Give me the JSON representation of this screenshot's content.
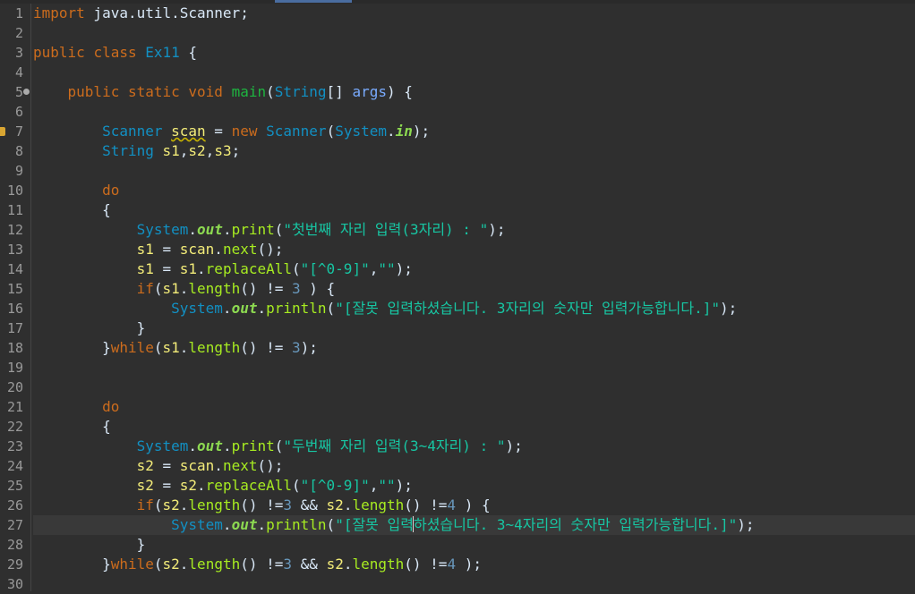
{
  "editor": {
    "colors": {
      "background": "#2f2f2f",
      "keyword": "#cc6c1d",
      "type": "#1290c3",
      "local_variable": "#f3ec79",
      "method": "#a7ec21",
      "string": "#17c6a3",
      "static_field": "#8dda51",
      "number": "#6897bb"
    },
    "current_line": 27,
    "lines": [
      {
        "n": "1",
        "t": [
          {
            "c": "kw",
            "s": "import"
          },
          {
            "c": "tx",
            "s": " java.util.Scanner;"
          }
        ]
      },
      {
        "n": "2",
        "t": []
      },
      {
        "n": "3",
        "t": [
          {
            "c": "kw",
            "s": "public"
          },
          {
            "c": "tx",
            "s": " "
          },
          {
            "c": "kw",
            "s": "class"
          },
          {
            "c": "tx",
            "s": " "
          },
          {
            "c": "cls",
            "s": "Ex11"
          },
          {
            "c": "tx",
            "s": " {"
          }
        ]
      },
      {
        "n": "4",
        "t": []
      },
      {
        "n": "5",
        "ann": "override-icon",
        "t": [
          {
            "c": "tx",
            "s": "    "
          },
          {
            "c": "kw",
            "s": "public"
          },
          {
            "c": "tx",
            "s": " "
          },
          {
            "c": "kw",
            "s": "static"
          },
          {
            "c": "tx",
            "s": " "
          },
          {
            "c": "kw",
            "s": "void"
          },
          {
            "c": "tx",
            "s": " "
          },
          {
            "c": "fn",
            "s": "main"
          },
          {
            "c": "tx",
            "s": "("
          },
          {
            "c": "cls",
            "s": "String"
          },
          {
            "c": "tx",
            "s": "[] "
          },
          {
            "c": "prm",
            "s": "args"
          },
          {
            "c": "tx",
            "s": ") {"
          }
        ]
      },
      {
        "n": "6",
        "t": []
      },
      {
        "n": "7",
        "marker": "warning-marker-icon",
        "t": [
          {
            "c": "tx",
            "s": "        "
          },
          {
            "c": "cls",
            "s": "Scanner"
          },
          {
            "c": "tx",
            "s": " "
          },
          {
            "c": "var warn",
            "s": "scan"
          },
          {
            "c": "tx",
            "s": " = "
          },
          {
            "c": "kw",
            "s": "new"
          },
          {
            "c": "tx",
            "s": " "
          },
          {
            "c": "cls",
            "s": "Scanner"
          },
          {
            "c": "tx",
            "s": "("
          },
          {
            "c": "cls",
            "s": "System"
          },
          {
            "c": "tx",
            "s": "."
          },
          {
            "c": "fld",
            "s": "in"
          },
          {
            "c": "tx",
            "s": ");"
          }
        ]
      },
      {
        "n": "8",
        "t": [
          {
            "c": "tx",
            "s": "        "
          },
          {
            "c": "cls",
            "s": "String"
          },
          {
            "c": "tx",
            "s": " "
          },
          {
            "c": "var",
            "s": "s1"
          },
          {
            "c": "tx",
            "s": ","
          },
          {
            "c": "var",
            "s": "s2"
          },
          {
            "c": "tx",
            "s": ","
          },
          {
            "c": "var",
            "s": "s3"
          },
          {
            "c": "tx",
            "s": ";"
          }
        ]
      },
      {
        "n": "9",
        "t": []
      },
      {
        "n": "10",
        "t": [
          {
            "c": "tx",
            "s": "        "
          },
          {
            "c": "kw",
            "s": "do"
          }
        ]
      },
      {
        "n": "11",
        "t": [
          {
            "c": "tx",
            "s": "        {"
          }
        ]
      },
      {
        "n": "12",
        "t": [
          {
            "c": "tx",
            "s": "            "
          },
          {
            "c": "cls",
            "s": "System"
          },
          {
            "c": "tx",
            "s": "."
          },
          {
            "c": "fld",
            "s": "out"
          },
          {
            "c": "tx",
            "s": "."
          },
          {
            "c": "mth",
            "s": "print"
          },
          {
            "c": "tx",
            "s": "("
          },
          {
            "c": "str",
            "s": "\"첫번째 자리 입력(3자리) : \""
          },
          {
            "c": "tx",
            "s": ");"
          }
        ]
      },
      {
        "n": "13",
        "t": [
          {
            "c": "tx",
            "s": "            "
          },
          {
            "c": "var",
            "s": "s1"
          },
          {
            "c": "tx",
            "s": " = "
          },
          {
            "c": "var",
            "s": "scan"
          },
          {
            "c": "tx",
            "s": "."
          },
          {
            "c": "mth",
            "s": "next"
          },
          {
            "c": "tx",
            "s": "();"
          }
        ]
      },
      {
        "n": "14",
        "t": [
          {
            "c": "tx",
            "s": "            "
          },
          {
            "c": "var",
            "s": "s1"
          },
          {
            "c": "tx",
            "s": " = "
          },
          {
            "c": "var",
            "s": "s1"
          },
          {
            "c": "tx",
            "s": "."
          },
          {
            "c": "mth",
            "s": "replaceAll"
          },
          {
            "c": "tx",
            "s": "("
          },
          {
            "c": "str",
            "s": "\"[^0-9]\""
          },
          {
            "c": "tx",
            "s": ","
          },
          {
            "c": "str",
            "s": "\"\""
          },
          {
            "c": "tx",
            "s": ");"
          }
        ]
      },
      {
        "n": "15",
        "t": [
          {
            "c": "tx",
            "s": "            "
          },
          {
            "c": "kw",
            "s": "if"
          },
          {
            "c": "tx",
            "s": "("
          },
          {
            "c": "var",
            "s": "s1"
          },
          {
            "c": "tx",
            "s": "."
          },
          {
            "c": "mth",
            "s": "length"
          },
          {
            "c": "tx",
            "s": "() != "
          },
          {
            "c": "numl",
            "s": "3"
          },
          {
            "c": "tx",
            "s": " ) {"
          }
        ]
      },
      {
        "n": "16",
        "t": [
          {
            "c": "tx",
            "s": "                "
          },
          {
            "c": "cls",
            "s": "System"
          },
          {
            "c": "tx",
            "s": "."
          },
          {
            "c": "fld",
            "s": "out"
          },
          {
            "c": "tx",
            "s": "."
          },
          {
            "c": "mth",
            "s": "println"
          },
          {
            "c": "tx",
            "s": "("
          },
          {
            "c": "str",
            "s": "\"[잘못 입력하셨습니다. 3자리의 숫자만 입력가능합니다.]\""
          },
          {
            "c": "tx",
            "s": ");"
          }
        ]
      },
      {
        "n": "17",
        "t": [
          {
            "c": "tx",
            "s": "            }"
          }
        ]
      },
      {
        "n": "18",
        "t": [
          {
            "c": "tx",
            "s": "        }"
          },
          {
            "c": "kw",
            "s": "while"
          },
          {
            "c": "tx",
            "s": "("
          },
          {
            "c": "var",
            "s": "s1"
          },
          {
            "c": "tx",
            "s": "."
          },
          {
            "c": "mth",
            "s": "length"
          },
          {
            "c": "tx",
            "s": "() != "
          },
          {
            "c": "numl",
            "s": "3"
          },
          {
            "c": "tx",
            "s": ");"
          }
        ]
      },
      {
        "n": "19",
        "t": []
      },
      {
        "n": "20",
        "t": []
      },
      {
        "n": "21",
        "t": [
          {
            "c": "tx",
            "s": "        "
          },
          {
            "c": "kw",
            "s": "do"
          }
        ]
      },
      {
        "n": "22",
        "t": [
          {
            "c": "tx",
            "s": "        {"
          }
        ]
      },
      {
        "n": "23",
        "t": [
          {
            "c": "tx",
            "s": "            "
          },
          {
            "c": "cls",
            "s": "System"
          },
          {
            "c": "tx",
            "s": "."
          },
          {
            "c": "fld",
            "s": "out"
          },
          {
            "c": "tx",
            "s": "."
          },
          {
            "c": "mth",
            "s": "print"
          },
          {
            "c": "tx",
            "s": "("
          },
          {
            "c": "str",
            "s": "\"두번째 자리 입력(3~4자리) : \""
          },
          {
            "c": "tx",
            "s": ");"
          }
        ]
      },
      {
        "n": "24",
        "t": [
          {
            "c": "tx",
            "s": "            "
          },
          {
            "c": "var",
            "s": "s2"
          },
          {
            "c": "tx",
            "s": " = "
          },
          {
            "c": "var",
            "s": "scan"
          },
          {
            "c": "tx",
            "s": "."
          },
          {
            "c": "mth",
            "s": "next"
          },
          {
            "c": "tx",
            "s": "();"
          }
        ]
      },
      {
        "n": "25",
        "t": [
          {
            "c": "tx",
            "s": "            "
          },
          {
            "c": "var",
            "s": "s2"
          },
          {
            "c": "tx",
            "s": " = "
          },
          {
            "c": "var",
            "s": "s2"
          },
          {
            "c": "tx",
            "s": "."
          },
          {
            "c": "mth",
            "s": "replaceAll"
          },
          {
            "c": "tx",
            "s": "("
          },
          {
            "c": "str",
            "s": "\"[^0-9]\""
          },
          {
            "c": "tx",
            "s": ","
          },
          {
            "c": "str",
            "s": "\"\""
          },
          {
            "c": "tx",
            "s": ");"
          }
        ]
      },
      {
        "n": "26",
        "t": [
          {
            "c": "tx",
            "s": "            "
          },
          {
            "c": "kw",
            "s": "if"
          },
          {
            "c": "tx",
            "s": "("
          },
          {
            "c": "var",
            "s": "s2"
          },
          {
            "c": "tx",
            "s": "."
          },
          {
            "c": "mth",
            "s": "length"
          },
          {
            "c": "tx",
            "s": "() !="
          },
          {
            "c": "numl",
            "s": "3"
          },
          {
            "c": "tx",
            "s": " && "
          },
          {
            "c": "var",
            "s": "s2"
          },
          {
            "c": "tx",
            "s": "."
          },
          {
            "c": "mth",
            "s": "length"
          },
          {
            "c": "tx",
            "s": "() !="
          },
          {
            "c": "numl",
            "s": "4"
          },
          {
            "c": "tx",
            "s": " ) {"
          }
        ]
      },
      {
        "n": "27",
        "t": [
          {
            "c": "tx",
            "s": "                "
          },
          {
            "c": "cls",
            "s": "System"
          },
          {
            "c": "tx",
            "s": "."
          },
          {
            "c": "fld",
            "s": "out"
          },
          {
            "c": "tx",
            "s": "."
          },
          {
            "c": "mth",
            "s": "println"
          },
          {
            "c": "tx",
            "s": "("
          },
          {
            "c": "str",
            "s": "\"[잘못 입력"
          },
          {
            "c": "caret",
            "s": ""
          },
          {
            "c": "str",
            "s": "하셨습니다. 3~4자리의 숫자만 입력가능합니다.]\""
          },
          {
            "c": "tx",
            "s": ");"
          }
        ]
      },
      {
        "n": "28",
        "t": [
          {
            "c": "tx",
            "s": "            }"
          }
        ]
      },
      {
        "n": "29",
        "t": [
          {
            "c": "tx",
            "s": "        }"
          },
          {
            "c": "kw",
            "s": "while"
          },
          {
            "c": "tx",
            "s": "("
          },
          {
            "c": "var",
            "s": "s2"
          },
          {
            "c": "tx",
            "s": "."
          },
          {
            "c": "mth",
            "s": "length"
          },
          {
            "c": "tx",
            "s": "() !="
          },
          {
            "c": "numl",
            "s": "3"
          },
          {
            "c": "tx",
            "s": " && "
          },
          {
            "c": "var",
            "s": "s2"
          },
          {
            "c": "tx",
            "s": "."
          },
          {
            "c": "mth",
            "s": "length"
          },
          {
            "c": "tx",
            "s": "() !="
          },
          {
            "c": "numl",
            "s": "4"
          },
          {
            "c": "tx",
            "s": " );"
          }
        ]
      },
      {
        "n": "30",
        "t": []
      }
    ]
  }
}
